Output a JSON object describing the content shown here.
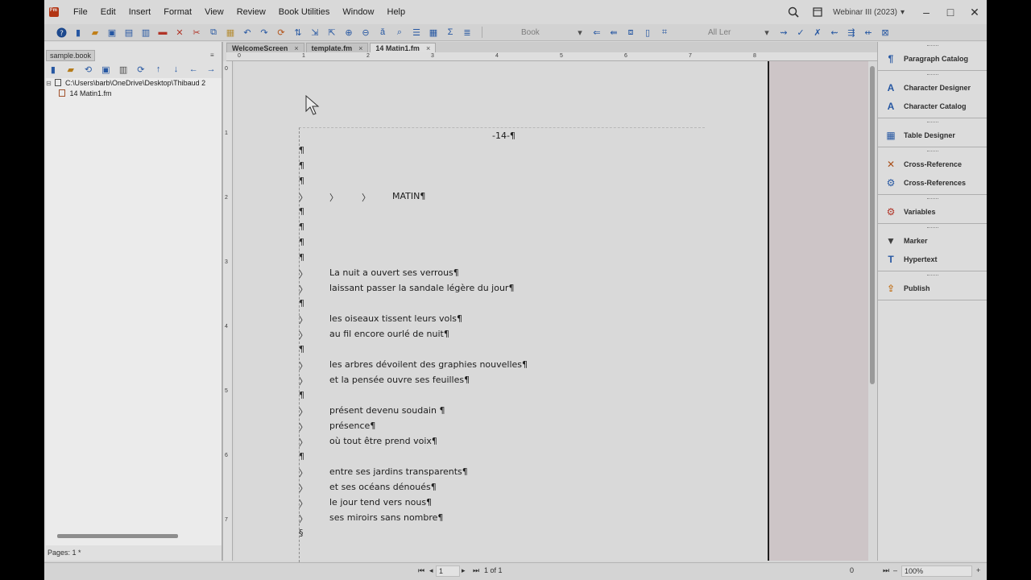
{
  "menubar": {
    "items": [
      "File",
      "Edit",
      "Insert",
      "Format",
      "View",
      "Review",
      "Book Utilities",
      "Window",
      "Help"
    ],
    "workspace": "Webinar III (2023)",
    "workspace_arrow": "▾"
  },
  "toolbar": {
    "style_select": "Book",
    "filter_select": "All Ler"
  },
  "leftpod": {
    "tab": "sample.book",
    "tree": [
      {
        "label": "C:\\Users\\barb\\OneDrive\\Desktop\\Thibaud 2"
      },
      {
        "label": "14 Matin1.fm"
      }
    ],
    "pages_label": "Pages: 1 *"
  },
  "doctabs": [
    {
      "label": "WelcomeScreen",
      "close": "×"
    },
    {
      "label": "template.fm",
      "close": "×"
    },
    {
      "label": "14 Matin1.fm",
      "close": "×"
    }
  ],
  "rulers": {
    "h": [
      "0",
      "1",
      "2",
      "3",
      "4",
      "5",
      "6",
      "7",
      "8"
    ],
    "v": [
      "0",
      "1",
      "2",
      "3",
      "4",
      "5",
      "6",
      "7"
    ]
  },
  "document": {
    "page_number": "-14-¶",
    "pilcrow": "¶",
    "tab_char": "〉",
    "section_end": "§",
    "title": "MATIN¶",
    "lines": [
      "La nuit a ouvert ses verrous¶",
      "laissant passer la sandale légère du jour¶",
      "les oiseaux tissent leurs vols¶",
      "au fil encore ourlé de nuit¶",
      "les arbres dévoilent des graphies nouvelles¶",
      "et la pensée ouvre ses feuilles¶",
      "présent devenu soudain ¶",
      "présence¶",
      "où tout être prend voix¶",
      "entre ses jardins transparents¶",
      "et ses océans dénoués¶",
      "le jour tend vers nous¶",
      "ses miroirs sans nombre¶"
    ]
  },
  "rightpanel": {
    "groups": [
      [
        {
          "label": "Paragraph Catalog",
          "icon": "paragraph-catalog-icon"
        }
      ],
      [
        {
          "label": "Character Designer",
          "icon": "character-designer-icon"
        },
        {
          "label": "Character Catalog",
          "icon": "character-catalog-icon"
        }
      ],
      [
        {
          "label": "Table Designer",
          "icon": "table-designer-icon"
        }
      ],
      [
        {
          "label": "Cross-Reference",
          "icon": "cross-reference-icon"
        },
        {
          "label": "Cross-References",
          "icon": "cross-references-icon"
        }
      ],
      [
        {
          "label": "Variables",
          "icon": "variables-icon"
        }
      ],
      [
        {
          "label": "Marker",
          "icon": "marker-icon"
        },
        {
          "label": "Hypertext",
          "icon": "hypertext-icon"
        }
      ],
      [
        {
          "label": "Publish",
          "icon": "publish-icon"
        }
      ]
    ]
  },
  "statusbar": {
    "page_current": "1",
    "page_total": "1 of 1",
    "x_value": "0",
    "zoom": "100%"
  },
  "colors": {
    "accent": "#2a5fb0",
    "danger": "#c0392b",
    "pasteboard": "#dfd6d8"
  }
}
